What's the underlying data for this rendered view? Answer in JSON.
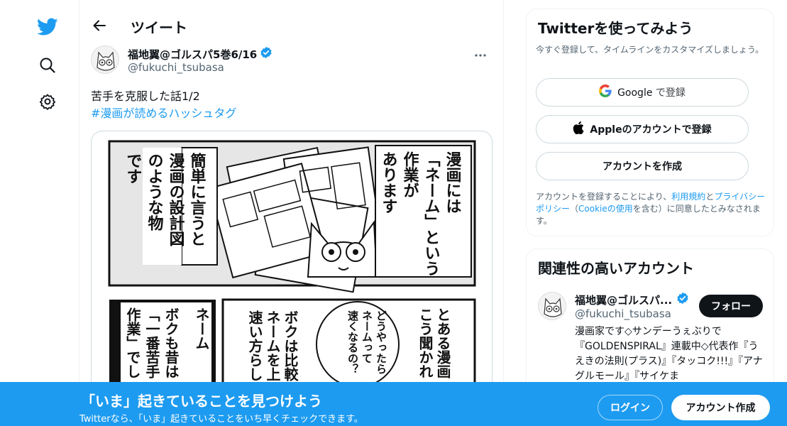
{
  "colors": {
    "accent": "#1d9bf0",
    "text": "#0f1419",
    "muted": "#536471",
    "banner": "#1d9bf0"
  },
  "nav": {
    "icons": [
      "twitter-logo-icon",
      "search-icon",
      "settings-icon"
    ]
  },
  "header": {
    "title": "ツイート",
    "back_icon": "arrow-left-icon"
  },
  "tweet": {
    "author_name": "福地翼@ゴルスパ5巻6/16",
    "author_handle": "@fukuchi_tsubasa",
    "text": "苦手を克服した話1/2",
    "hashtag": "#漫画が読めるハッシュタグ",
    "more_icon": "more-horizontal-icon"
  },
  "comic": {
    "panel1_left": [
      "簡単に言うと",
      "漫画の設計図",
      "のような物",
      "です"
    ],
    "panel1_right": [
      "漫画には",
      "「ネーム」という",
      "作業が",
      "あります"
    ],
    "panel2_cols": [
      "とある漫画",
      "こう聞かれ",
      "どうやったら",
      "ネームって",
      "速くなるの？",
      "ボクは比較",
      "ネームを上",
      "速い方らし",
      "ネーム",
      "ボクも昔は",
      "「一番苦手",
      "作業」でし"
    ]
  },
  "signup": {
    "title": "Twitterを使ってみよう",
    "subtitle": "今すぐ登録して、タイムラインをカスタマイズしましょう。",
    "google_label": "Google",
    "google_suffix": "で登録",
    "apple_label": "Appleのアカウントで登録",
    "create_label": "アカウントを作成",
    "legal_prefix": "アカウントを登録することにより、",
    "legal_terms": "利用規約",
    "legal_and": "と",
    "legal_privacy": "プライバシーポリシー",
    "legal_paren_open": "（",
    "legal_cookie": "Cookieの使用",
    "legal_suffix": "を含む）に同意したとみなされます。"
  },
  "related": {
    "title": "関連性の高いアカウント",
    "name": "福地翼@ゴルスパ...",
    "handle": "@fukuchi_tsubasa",
    "follow_label": "フォロー",
    "bio": "漫画家です◇サンデーうぇぶりで『GOLDENSPIRAL』連載中◇代表作『うえきの法則(プラス)』『タッコク!!!』『アナグルモール』『サイケま"
  },
  "banner": {
    "title": "「いま」起きていることを見つけよう",
    "subtitle": "Twitterなら、「いま」起きていることをいち早くチェックできます。",
    "login_label": "ログイン",
    "create_label": "アカウント作成"
  }
}
